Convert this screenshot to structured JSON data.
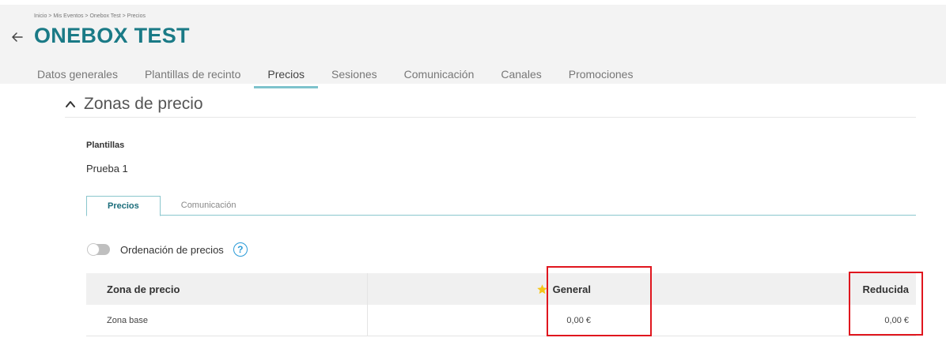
{
  "breadcrumb": [
    "Inicio",
    "Mis Eventos",
    "Onebox Test",
    "Precios"
  ],
  "breadcrumb_separator": ">",
  "page_title": "ONEBOX TEST",
  "main_tabs": [
    {
      "label": "Datos generales"
    },
    {
      "label": "Plantillas de recinto"
    },
    {
      "label": "Precios"
    },
    {
      "label": "Sesiones"
    },
    {
      "label": "Comunicación"
    },
    {
      "label": "Canales"
    },
    {
      "label": "Promociones"
    }
  ],
  "active_main_tab": "Precios",
  "section": {
    "title": "Zonas de precio"
  },
  "plantillas": {
    "label": "Plantillas",
    "value": "Prueba 1"
  },
  "sub_tabs": [
    {
      "label": "Precios"
    },
    {
      "label": "Comunicación"
    }
  ],
  "active_sub_tab": "Precios",
  "ordering": {
    "label": "Ordenación de precios",
    "enabled": false,
    "help_glyph": "?"
  },
  "table": {
    "headers": {
      "zone": "Zona de precio",
      "general": "General",
      "reducida": "Reducida"
    },
    "rows": [
      {
        "zone": "Zona base",
        "general": "0,00 €",
        "reducida": "0,00 €"
      }
    ]
  },
  "icons": {
    "back": "arrow-left-icon",
    "section_toggle": "chevron-up-icon",
    "help": "question-circle-icon",
    "default_rate": "star-icon"
  },
  "colors": {
    "brand": "#1a7a86",
    "tab_indicator": "#7ec3cc",
    "highlight": "#e0161e",
    "star": "#f5c518",
    "help": "#2a9bd8"
  }
}
